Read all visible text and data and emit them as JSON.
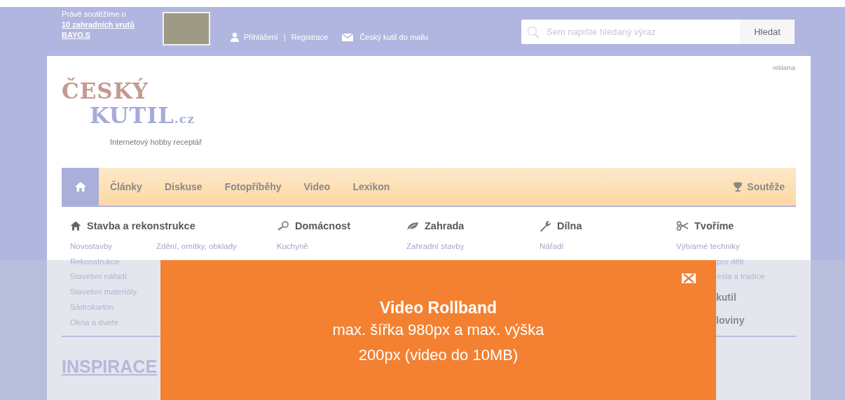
{
  "contest": {
    "intro": "Právě soutěžíme o",
    "prize": "10 zahradních vrutů BAYO.S"
  },
  "account": {
    "login": "Přihlášení",
    "separator": "|",
    "register": "Registrace",
    "newsletter": "Český kutil do mailu"
  },
  "search": {
    "placeholder": "Sem napište hledaný výraz",
    "button": "Hledat"
  },
  "ad_label": "reklama",
  "logo": {
    "line1": "ČESKÝ",
    "line2": "KUTIL",
    "suffix": ".cz",
    "tagline": "Internetový hobby receptář"
  },
  "nav": [
    {
      "kind": "home",
      "selected": true
    },
    {
      "kind": "link",
      "label": "Články",
      "selected": false
    },
    {
      "kind": "link",
      "label": "Diskuse",
      "selected": false
    },
    {
      "kind": "link",
      "label": "Fotopříběhy",
      "selected": false
    },
    {
      "kind": "link",
      "label": "Video",
      "selected": false
    },
    {
      "kind": "link",
      "label": "Lexikon",
      "selected": false
    },
    {
      "kind": "contest",
      "label": "Soutěže",
      "selected": false
    }
  ],
  "categories": [
    {
      "title": "Stavba a rekonstrukce",
      "lists": [
        [
          {
            "kind": "link",
            "text": "Novostavby"
          },
          {
            "kind": "link",
            "text": "Rekonstrukce"
          },
          {
            "kind": "link",
            "text": "Stavební nářadí"
          },
          {
            "kind": "link",
            "text": "Stavební materiály"
          },
          {
            "kind": "link",
            "text": "Sádrokarton"
          },
          {
            "kind": "link",
            "text": "Okna a dveře"
          }
        ],
        [
          {
            "kind": "link",
            "text": "Zdění, omítky, obklady"
          }
        ]
      ]
    },
    {
      "title": "Domácnost",
      "lists": [
        [
          {
            "kind": "link",
            "text": "Kuchyně"
          }
        ]
      ]
    },
    {
      "title": "Zahrada",
      "lists": [
        [
          {
            "kind": "link",
            "text": "Zahradní stavby"
          }
        ]
      ]
    },
    {
      "title": "Dílna",
      "lists": [
        [
          {
            "kind": "link",
            "text": "Nářadí"
          }
        ]
      ]
    },
    {
      "title": "Tvoříme",
      "lists": [
        [
          {
            "kind": "link",
            "text": "Výtvarné techniky"
          },
          {
            "kind": "partial",
            "text": "pro děti"
          },
          {
            "kind": "partial",
            "text": "esla a tradice"
          },
          {
            "kind": "heading",
            "text": "kutil"
          },
          {
            "kind": "heading",
            "text": "loviny"
          }
        ]
      ]
    }
  ],
  "inspiration": {
    "title": "INSPIRACE"
  },
  "ad_banner": {
    "title": "Video Rollband",
    "text": "max. šířka 980px a max. výška 200px (video do 10MB)"
  }
}
